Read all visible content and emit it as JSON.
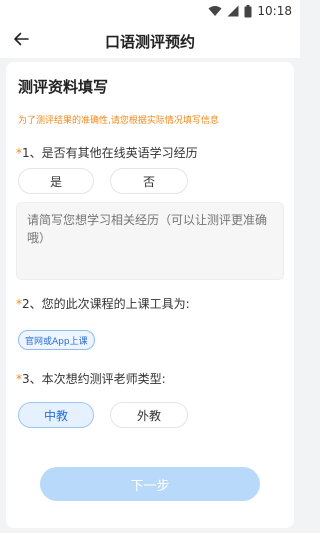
{
  "status_bar": {
    "time": "10:18",
    "icons": [
      "wifi-icon",
      "signal-icon",
      "battery-icon"
    ]
  },
  "app_bar": {
    "back_icon": "back-arrow-icon",
    "title": "口语测评预约"
  },
  "form": {
    "section_title": "测评资料填写",
    "notice": "为了测评结果的准确性,请您根据实际情况填写信息",
    "q1": {
      "marker": "*",
      "label": "1、是否有其他在线英语学习经历",
      "options": [
        "是",
        "否"
      ],
      "textarea_placeholder": "请简写您想学习相关经历（可以让测评更准确哦）"
    },
    "q2": {
      "marker": "*",
      "label": "2、您的此次课程的上课工具为:",
      "selected_tag": "官网或App上课"
    },
    "q3": {
      "marker": "*",
      "label": "3、本次想约测评老师类型:",
      "options": [
        "中教",
        "外教"
      ],
      "selected": "中教"
    },
    "next_button": "下一步"
  },
  "colors": {
    "accent": "#2b6fd3",
    "notice": "#f08a1c",
    "button_disabled": "#b9d9fa",
    "background": "#f2f3f5"
  }
}
